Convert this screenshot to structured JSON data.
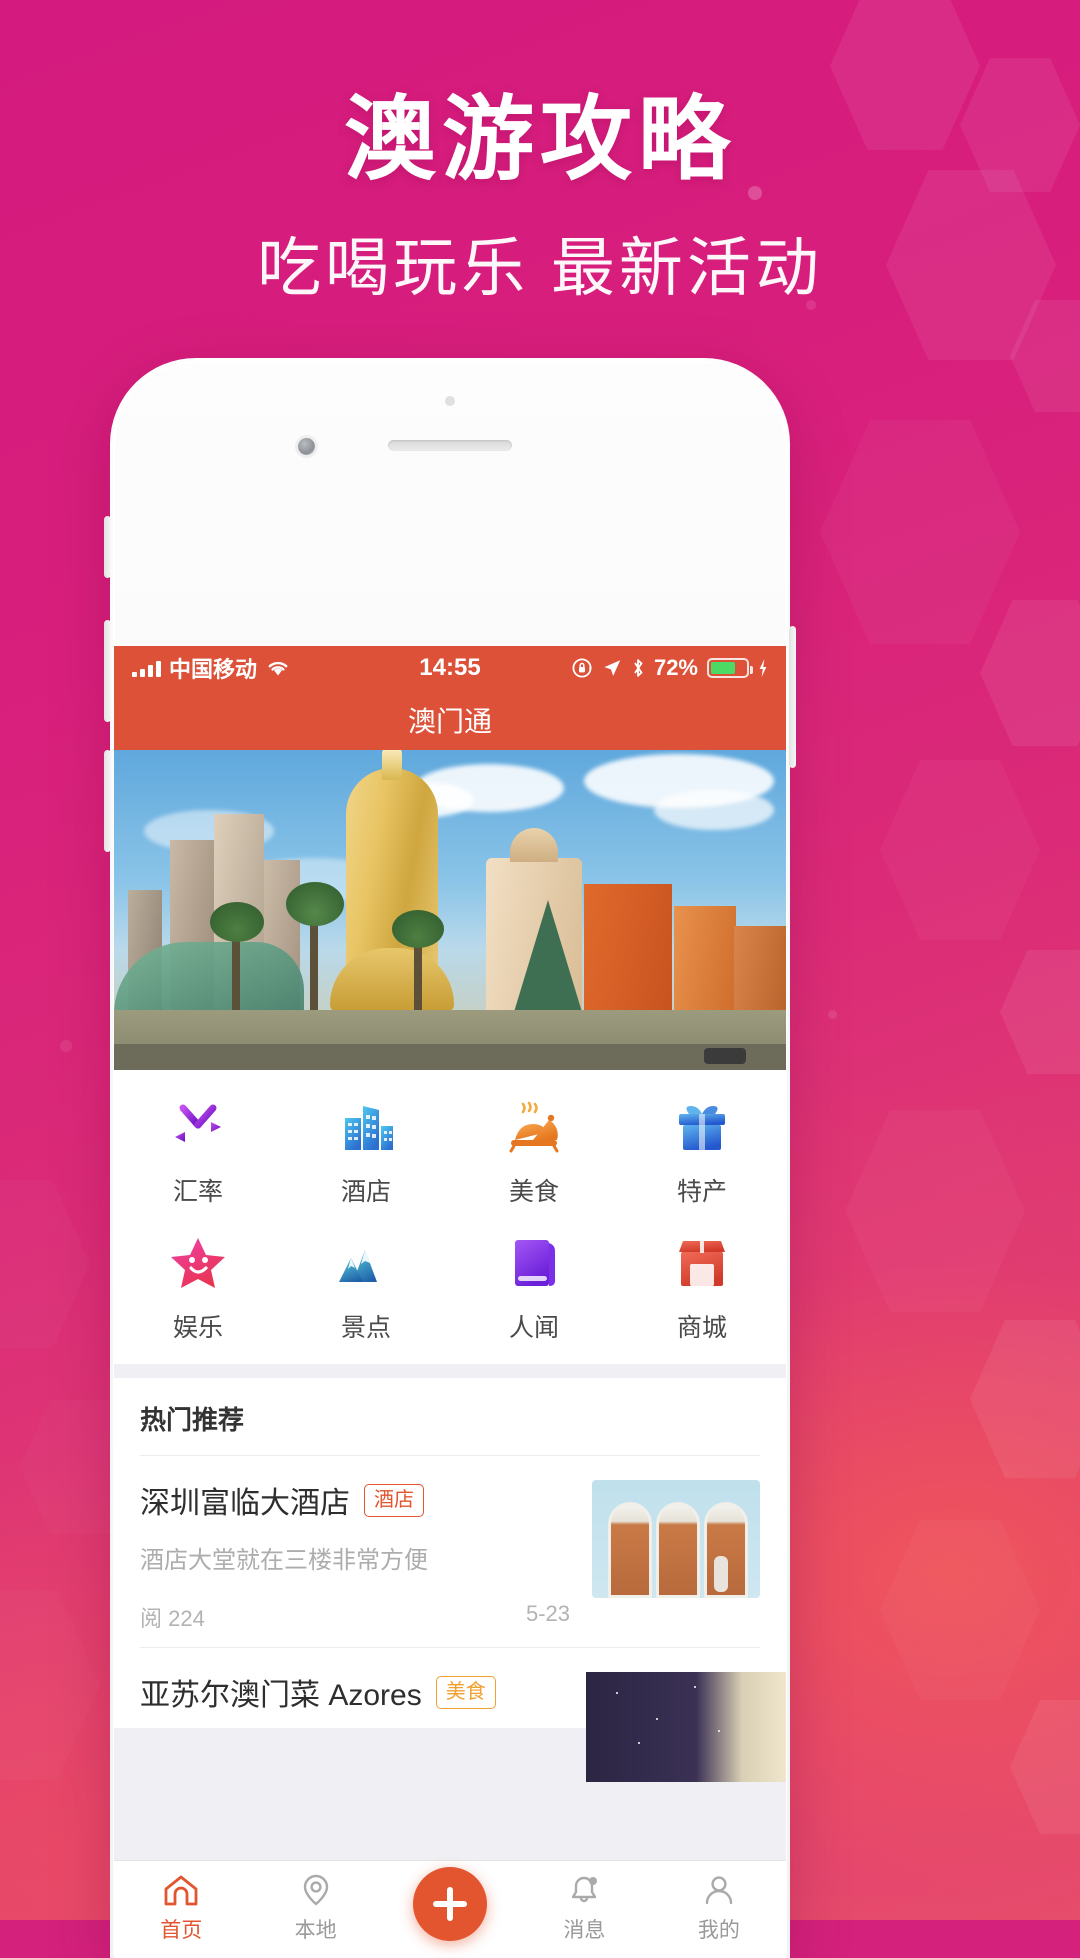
{
  "promo": {
    "title": "澳游攻略",
    "subtitle": "吃喝玩乐 最新活动",
    "bg_color": "#d8217c",
    "accent_color": "#e8526a"
  },
  "status_bar": {
    "carrier": "中国移动",
    "time": "14:55",
    "battery_percent": "72%",
    "signal_icon": "signal-bars-icon",
    "wifi_icon": "wifi-icon",
    "rotation_lock_icon": "rotation-lock-icon",
    "location_icon": "location-arrow-icon",
    "bluetooth_icon": "bluetooth-icon",
    "battery_icon": "battery-icon",
    "charging_icon": "lightning-bolt-icon",
    "bar_color": "#dd5138"
  },
  "navbar": {
    "title": "澳门通"
  },
  "hero": {
    "alt": "macau-skyline-banner"
  },
  "grid": {
    "items": [
      {
        "label": "汇率",
        "icon": "currency-exchange-icon",
        "color": "#9b34d9"
      },
      {
        "label": "酒店",
        "icon": "buildings-icon",
        "color": "#3aa8e0"
      },
      {
        "label": "美食",
        "icon": "food-dome-icon",
        "color": "#f08030"
      },
      {
        "label": "特产",
        "icon": "gift-box-icon",
        "color": "#2f7fe0"
      },
      {
        "label": "娱乐",
        "icon": "smiley-star-icon",
        "color": "#e5397a"
      },
      {
        "label": "景点",
        "icon": "mountains-icon",
        "color": "#2e8fb0"
      },
      {
        "label": "人闻",
        "icon": "book-icon",
        "color": "#8b3fe0"
      },
      {
        "label": "商城",
        "icon": "shop-icon",
        "color": "#e2503c"
      }
    ]
  },
  "hot": {
    "heading": "热门推荐",
    "items": [
      {
        "title": "深圳富临大酒店",
        "tag": "酒店",
        "tag_type": "hotel",
        "tag_color": "#e2552f",
        "desc": "酒店大堂就在三楼非常方便",
        "views_label": "阅 224",
        "date": "5-23",
        "thumb": "hotel-arches-photo"
      },
      {
        "title": "亚苏尔澳门菜 Azores",
        "tag": "美食",
        "tag_type": "food",
        "tag_color": "#f0a030",
        "thumb": "night-sky-photo"
      }
    ]
  },
  "tabbar": {
    "items": [
      {
        "label": "首页",
        "icon": "home-icon",
        "active": true
      },
      {
        "label": "本地",
        "icon": "location-pin-icon",
        "active": false
      },
      {
        "label": "消息",
        "icon": "bell-icon",
        "active": false
      },
      {
        "label": "我的",
        "icon": "person-icon",
        "active": false
      }
    ],
    "fab_icon": "plus-icon",
    "fab_color": "#e2552f"
  }
}
